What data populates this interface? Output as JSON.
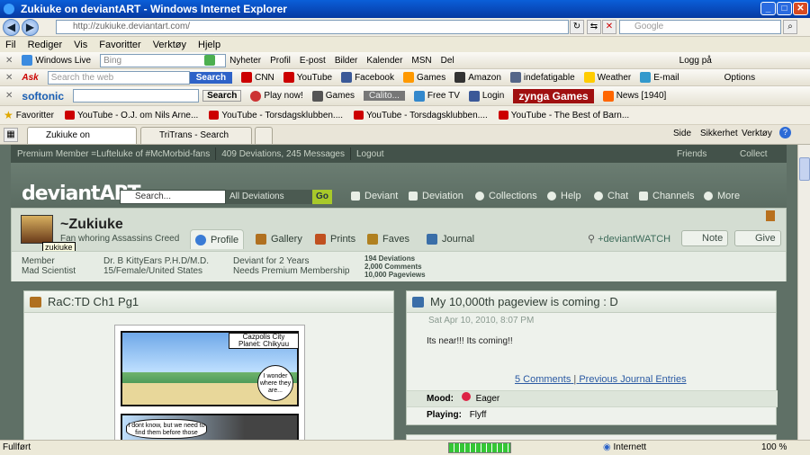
{
  "window": {
    "title": "Zukiuke on deviantART - Windows Internet Explorer"
  },
  "address": {
    "url": "http://zukiuke.deviantart.com/",
    "search_placeholder": "Google"
  },
  "menu": [
    "Fil",
    "Rediger",
    "Vis",
    "Favoritter",
    "Verktøy",
    "Hjelp"
  ],
  "live_bar": {
    "label": "Windows Live",
    "search_value": "Bing",
    "links": [
      "Nyheter",
      "Profil",
      "E-post",
      "Bilder",
      "Kalender",
      "MSN",
      "Del"
    ],
    "login": "Logg på"
  },
  "ask_bar": {
    "placeholder": "Search the web",
    "search_btn": "Search",
    "items": [
      "CNN",
      "YouTube",
      "Facebook",
      "Games",
      "Amazon",
      "indefatigable",
      "Weather",
      "E-mail"
    ],
    "options": "Options"
  },
  "softonic_bar": {
    "brand": "softonic",
    "search_btn": "Search",
    "items": [
      "Play now!",
      "Games",
      "Calito...",
      "Free TV",
      "Login"
    ],
    "zynga": "zynga Games",
    "news": "News [1940]"
  },
  "favorites_bar": {
    "label": "Favoritter",
    "links": [
      "YouTube - O.J. om Nils Arne...",
      "YouTube - Torsdagsklubben....",
      "YouTube - Torsdagsklubben....",
      "YouTube - The Best of Barn..."
    ]
  },
  "tabs": [
    {
      "label": "Zukiuke on deviantART"
    },
    {
      "label": "TriTrans - Search Result Page"
    }
  ],
  "tab_tools": {
    "side": "Side",
    "sikkerhet": "Sikkerhet",
    "verktoy": "Verktøy"
  },
  "da_topbar": {
    "member": "Premium Member =Lufteluke of #McMorbid-fans",
    "stats": "409 Deviations, 245 Messages",
    "logout": "Logout",
    "friends": "Friends",
    "collect": "Collect"
  },
  "da_header": {
    "logo": "deviantART",
    "search_placeholder": "Search...",
    "scope": "All Deviations",
    "go": "Go",
    "nav": [
      "Deviant",
      "Deviation",
      "Collections",
      "Help",
      "Chat",
      "Channels",
      "More"
    ]
  },
  "profile": {
    "username": "~Zukiuke",
    "tagline": "Fan whoring Assassins Creed",
    "tooltip": "zukiuke",
    "tabs": [
      "Profile",
      "Gallery",
      "Prints",
      "Faves",
      "Journal"
    ],
    "watch": "+deviantWATCH",
    "note": "Note",
    "give": "Give",
    "stats": {
      "role": "Member",
      "role2": "Mad Scientist",
      "name": "Dr. B KittyEars P.H.D/M.D.",
      "info": "15/Female/United States",
      "since": "Deviant for 2 Years",
      "premium": "Needs Premium Membership",
      "deviations": "194 Deviations",
      "comments": "2,000 Comments",
      "pageviews": "10,000 Pageviews"
    }
  },
  "deviation_panel": {
    "title": "RaC:TD Ch1 Pg1",
    "caption1": "Cazpolis City",
    "caption2": "Planet: Chikyuu",
    "bubble": "I wonder where they are...",
    "bubble2": "I dont know, but we need to find them before those"
  },
  "journal": {
    "title": "My 10,000th pageview is coming : D",
    "date": "Sat Apr 10, 2010, 8:07 PM",
    "text": "Its near!!! Its coming!!",
    "comments_link": "5 Comments",
    "prev_link": "Previous Journal Entries",
    "mood_label": "Mood:",
    "mood": "Eager",
    "playing_label": "Playing:",
    "playing": "Flyff"
  },
  "status": {
    "text": "Fullført",
    "zone": "Internett",
    "zoom": "100 %"
  }
}
